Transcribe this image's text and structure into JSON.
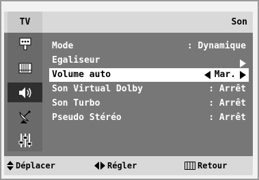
{
  "header": {
    "source": "TV",
    "title": "Son"
  },
  "sidebar": {
    "icons": [
      "antenna-input-icon",
      "channel-list-icon",
      "speaker-sound-icon",
      "satellite-dish-icon",
      "equalizer-sliders-icon"
    ],
    "active_index": 2
  },
  "menu": {
    "items": [
      {
        "label": "Mode",
        "value": ": Dynamique"
      },
      {
        "label": "Egaliseur",
        "value": ""
      },
      {
        "label": "Volume auto",
        "value": "Mar."
      },
      {
        "label": "Son Virtual Dolby",
        "value": ": Arrêt"
      },
      {
        "label": "Son Turbo",
        "value": ": Arrêt"
      },
      {
        "label": "Pseudo Stéréo",
        "value": ": Arrêt"
      }
    ],
    "selected_index": 2
  },
  "footer": {
    "move": "Déplacer",
    "adjust": "Régler",
    "back": "Retour"
  },
  "colors": {
    "panel": "#777777",
    "bar": "#d9d9d9",
    "selected_row": "#ffffff"
  }
}
